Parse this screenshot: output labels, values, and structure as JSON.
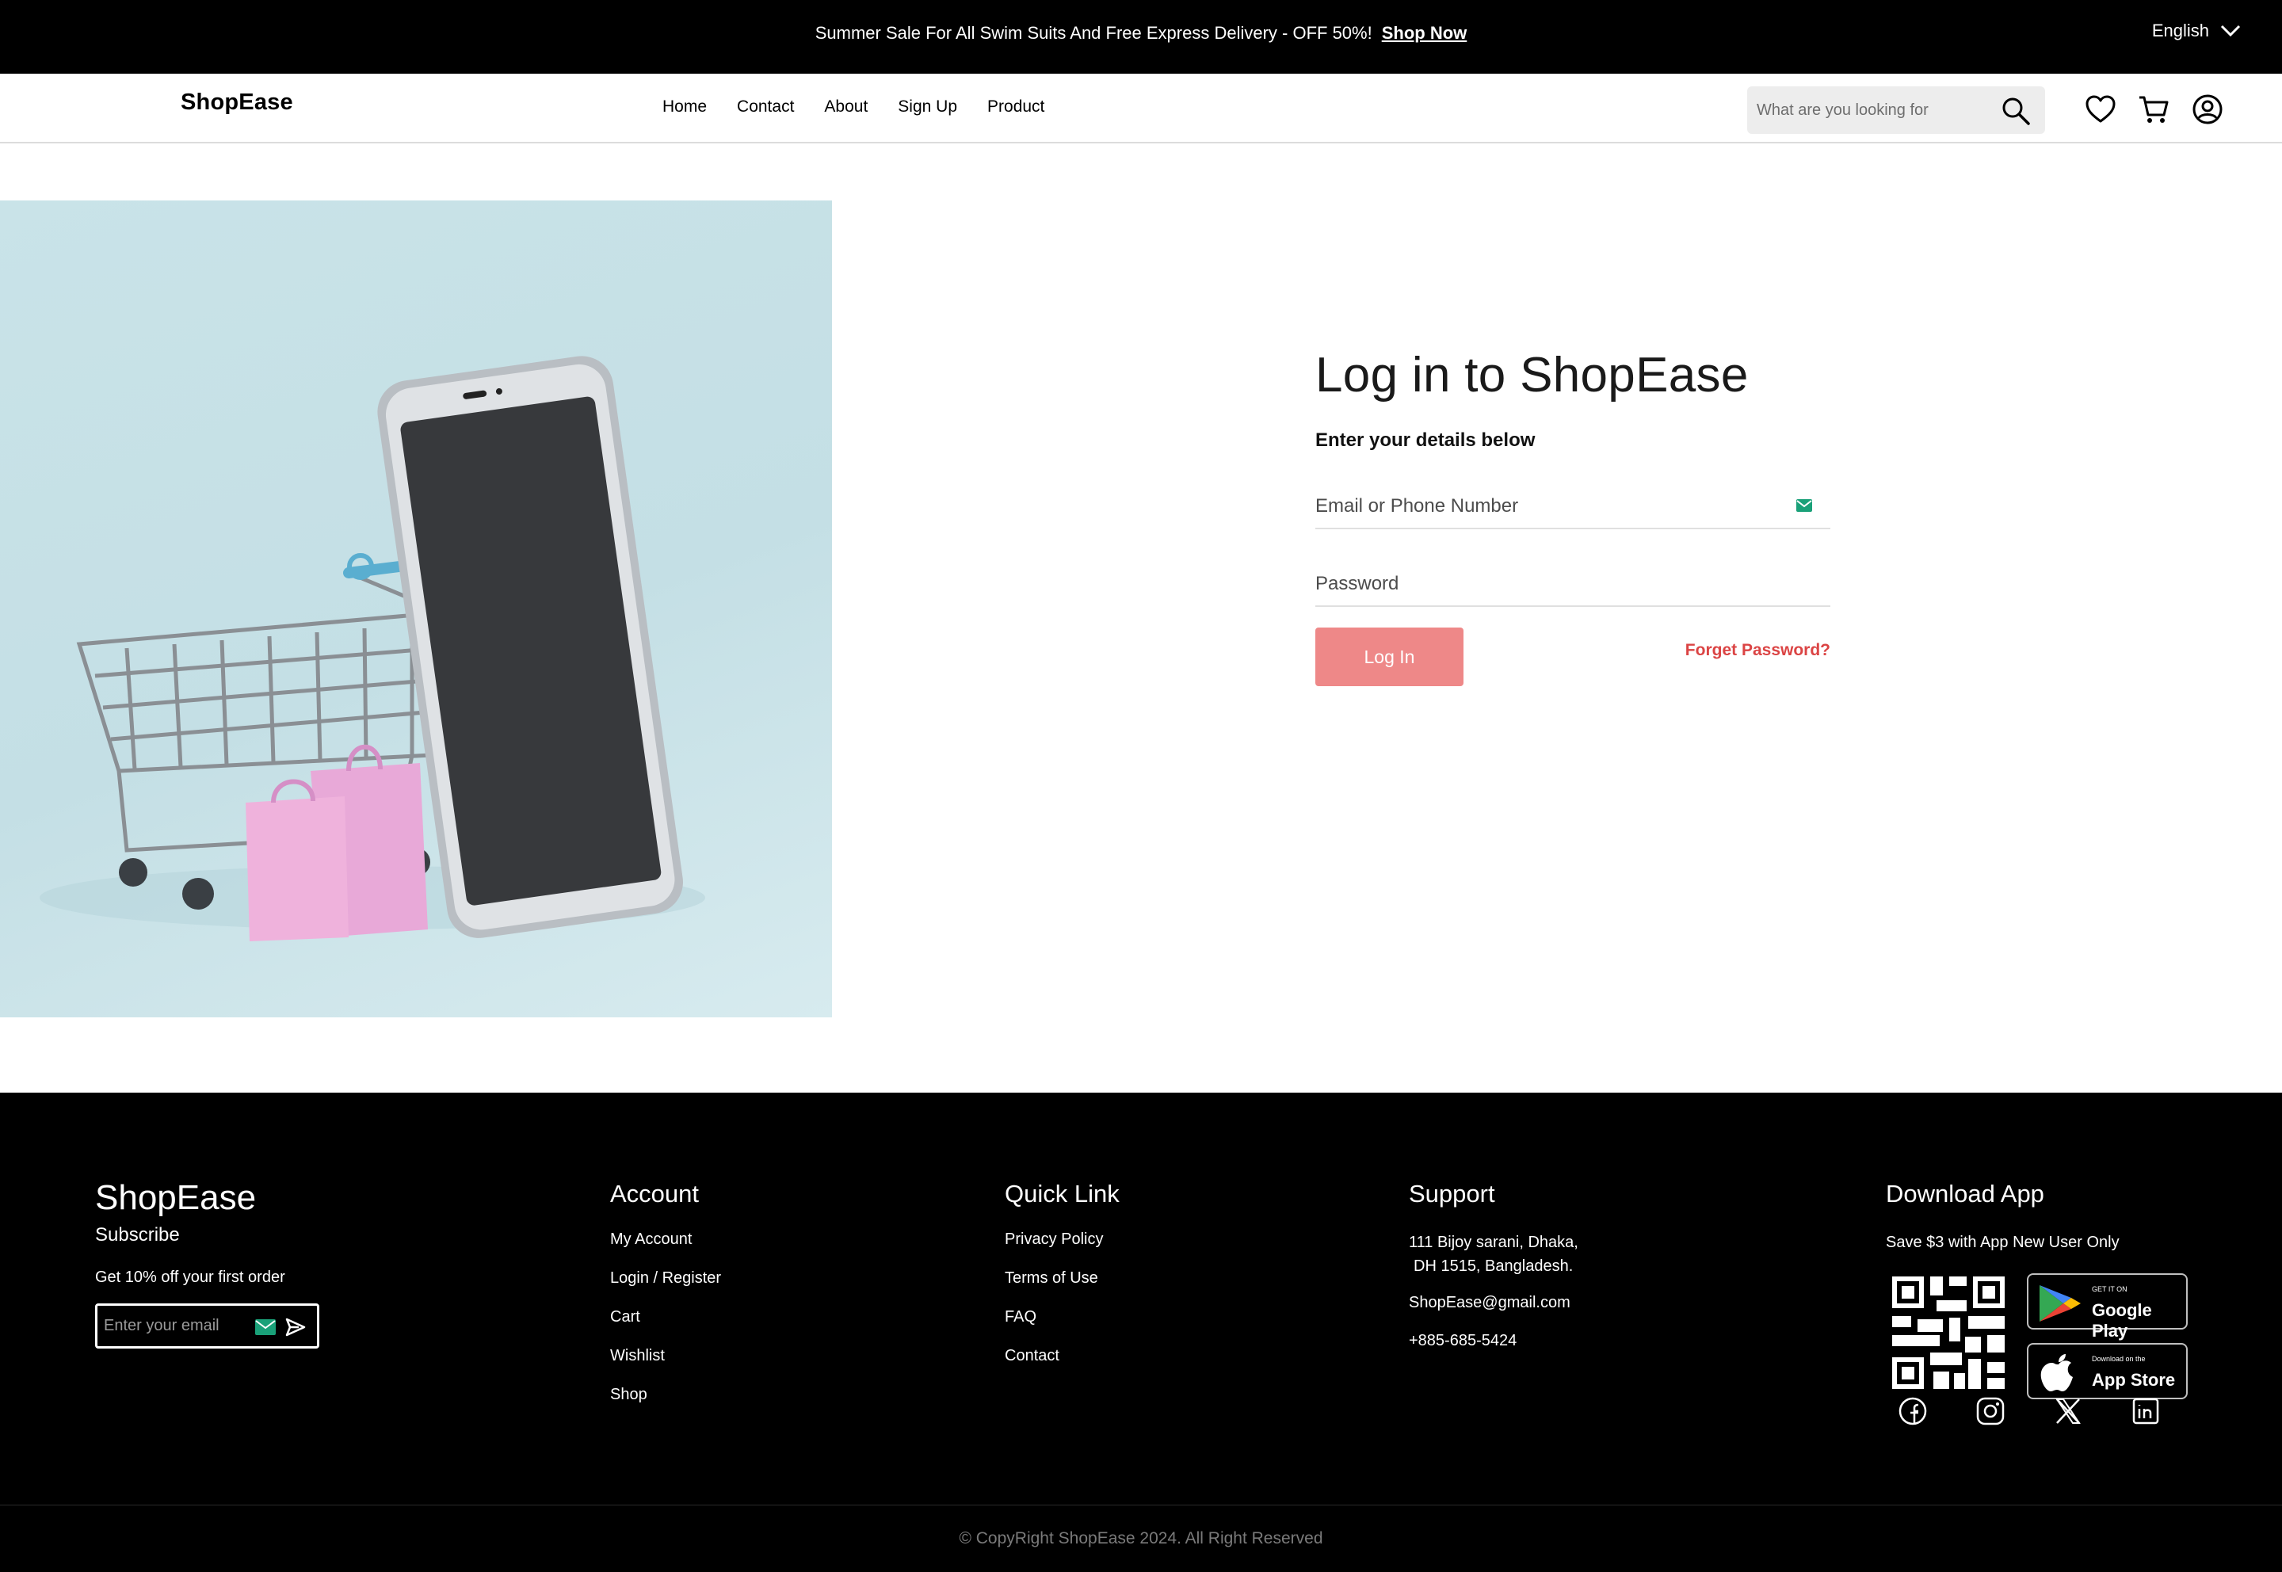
{
  "banner": {
    "promo_text": "Summer Sale For All Swim Suits And Free Express Delivery - OFF 50%!",
    "shop_now": "Shop Now",
    "language": "English"
  },
  "header": {
    "logo": "ShopEase",
    "nav": [
      "Home",
      "Contact",
      "About",
      "Sign Up",
      "Product"
    ],
    "search_placeholder": "What are you looking for",
    "icons": [
      "heart-icon",
      "cart-icon",
      "user-account-icon"
    ]
  },
  "login": {
    "title": "Log in to ShopEase",
    "subtitle": "Enter your details below",
    "email_placeholder": "Email or Phone Number",
    "password_placeholder": "Password",
    "login_button": "Log In",
    "forget_password": "Forget Password?"
  },
  "footer": {
    "brand": "ShopEase",
    "subscribe": "Subscribe",
    "offer": "Get 10% off your first order",
    "email_placeholder": "Enter your email",
    "account": {
      "heading": "Account",
      "links": [
        "My Account",
        "Login / Register",
        "Cart",
        "Wishlist",
        "Shop"
      ]
    },
    "quick_link": {
      "heading": "Quick Link",
      "links": [
        "Privacy Policy",
        "Terms of Use",
        "FAQ",
        "Contact"
      ]
    },
    "support": {
      "heading": "Support",
      "address_line1": "111 Bijoy sarani, Dhaka,",
      "address_line2": "DH 1515, Bangladesh.",
      "email": "ShopEase@gmail.com",
      "phone": "+885-685-5424"
    },
    "download": {
      "heading": "Download App",
      "promo": "Save $3 with App New User Only",
      "google_small": "GET IT ON",
      "google_big": "Google Play",
      "apple_small": "Download on the",
      "apple_big": "App Store"
    },
    "social": [
      "facebook-icon",
      "instagram-icon",
      "x-twitter-icon",
      "linkedin-icon"
    ],
    "copyright": "© CopyRight ShopEase 2024. All Right Reserved"
  },
  "colors": {
    "accent": "#db4444",
    "login_button": "#ee8888",
    "hero_bg": "#c9e3e8",
    "footer_bg": "#000000"
  }
}
